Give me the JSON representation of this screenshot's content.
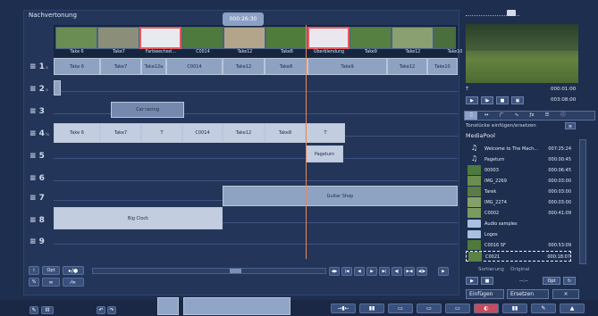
{
  "app_title": "Nachvertonung",
  "timecode": "000:26:30",
  "strip": [
    {
      "label": "Take 6"
    },
    {
      "label": "Take7"
    },
    {
      "label": "Farbwechsel..."
    },
    {
      "label": "C0014"
    },
    {
      "label": "Take12"
    },
    {
      "label": "Take8"
    },
    {
      "label": "Überblendung"
    },
    {
      "label": "Take9"
    },
    {
      "label": "Take12"
    },
    {
      "label": "Take10"
    }
  ],
  "tracks": [
    {
      "num": "1",
      "mark": "a"
    },
    {
      "num": "2",
      "mark": "a"
    },
    {
      "num": "3",
      "mark": ""
    },
    {
      "num": "4",
      "mark": "fx"
    },
    {
      "num": "5",
      "mark": ""
    },
    {
      "num": "6",
      "mark": ""
    },
    {
      "num": "7",
      "mark": ""
    },
    {
      "num": "8",
      "mark": ""
    },
    {
      "num": "9",
      "mark": ""
    }
  ],
  "track1_clips": [
    "Take 6",
    "Take7",
    "Take12a",
    "C0014",
    "Take12",
    "Take8",
    "Take9",
    "Take12",
    "Take10"
  ],
  "track4_clips": [
    "Take 6",
    "Take7",
    "T",
    "C0014",
    "Take12",
    "Take8",
    "T"
  ],
  "clip_labels": {
    "car": "Car racing",
    "page": "Pageturn",
    "guitar": "Guitar Shop",
    "clock": "Big Clock"
  },
  "toolbar": {
    "opt": "Opt",
    "i": "i",
    "pct": "%"
  },
  "preview": {
    "label": "T",
    "time1": "000:01:00",
    "time2": "003:08:00"
  },
  "panel": {
    "hint": "Tonstücke einfügen/ersetzen",
    "pool": "MediaPool",
    "sort": "Sortierung",
    "original": "Original",
    "dash": "--:--",
    "opt": "Opt"
  },
  "pool_items": [
    {
      "name": "Welcome to The Mach...",
      "dur": "007:25:24",
      "kind": "audio"
    },
    {
      "name": "Pageturn",
      "dur": "000:00:45",
      "kind": "audio"
    },
    {
      "name": "00003",
      "dur": "000:06:45",
      "kind": "video"
    },
    {
      "name": "IMG_2269",
      "dur": "000:03:00",
      "kind": "video"
    },
    {
      "name": "Tarek",
      "dur": "000:03:00",
      "kind": "video"
    },
    {
      "name": "IMG_2274",
      "dur": "000:03:00",
      "kind": "video"
    },
    {
      "name": "C0002",
      "dur": "000:41:09",
      "kind": "video"
    },
    {
      "name": "Audio samples",
      "dur": "",
      "kind": "folder"
    },
    {
      "name": "Logos",
      "dur": "",
      "kind": "folder"
    },
    {
      "name": "C0016 SF",
      "dur": "000:53:09",
      "kind": "video"
    },
    {
      "name": "C0021",
      "dur": "000:18:07",
      "kind": "video"
    }
  ],
  "buttons": {
    "insert": "Einfügen",
    "replace": "Ersetzen",
    "close": "×"
  }
}
